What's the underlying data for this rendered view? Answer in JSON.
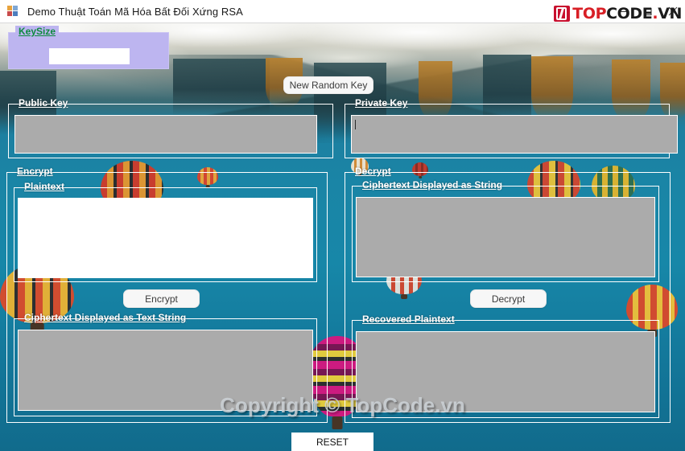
{
  "window": {
    "title": "Demo Thuật Toán Mã Hóa Bất Đối Xứng RSA",
    "icon": "app-window-icon",
    "controls": {
      "minimize": "minimize-icon",
      "maximize": "maximize-icon",
      "close": "close-icon"
    }
  },
  "brand": {
    "logo_part1": "TOP",
    "logo_part2": "CODE",
    "logo_dot": ".",
    "logo_part3": "VN",
    "watermark_top": "TopCode.vn",
    "watermark_bottom": "Copyright © TopCode.vn",
    "accent_red": "#d81f26",
    "accent_black": "#1b1b1b"
  },
  "theme": {
    "background_teal": "#1a85a6",
    "group_border": "#ffffff",
    "legend_color": "#ffffff",
    "keysize_legend_color": "#0d8a3e",
    "keysize_panel": "#bdb5f0",
    "disabled_field": "#ababab",
    "editable_field": "#ffffff"
  },
  "groups": {
    "keysize": {
      "legend": "KeySize"
    },
    "public_key": {
      "legend": "Public Key"
    },
    "private_key": {
      "legend": "Private Key"
    },
    "encrypt": {
      "legend": "Encrypt"
    },
    "plaintext": {
      "legend": "Plaintext"
    },
    "ciphertext_text_string": {
      "legend": "Ciphertext Displayed as Text String"
    },
    "decrypt": {
      "legend": "Decrypt"
    },
    "ciphertext_string": {
      "legend": "Ciphertext Displayed as String"
    },
    "recovered_plaintext": {
      "legend": "Recovered Plaintext"
    }
  },
  "fields": {
    "keysize": {
      "value": "",
      "placeholder": ""
    },
    "public_key": {
      "value": "",
      "placeholder": ""
    },
    "private_key": {
      "value": "",
      "placeholder": ""
    },
    "plaintext": {
      "value": "",
      "placeholder": ""
    },
    "ciphertext_text_string": {
      "value": "",
      "placeholder": ""
    },
    "ciphertext_string": {
      "value": "",
      "placeholder": ""
    },
    "recovered_plaintext": {
      "value": "",
      "placeholder": ""
    }
  },
  "buttons": {
    "new_random_key": "New Random Key",
    "encrypt": "Encrypt",
    "decrypt": "Decrypt",
    "reset": "RESET"
  }
}
